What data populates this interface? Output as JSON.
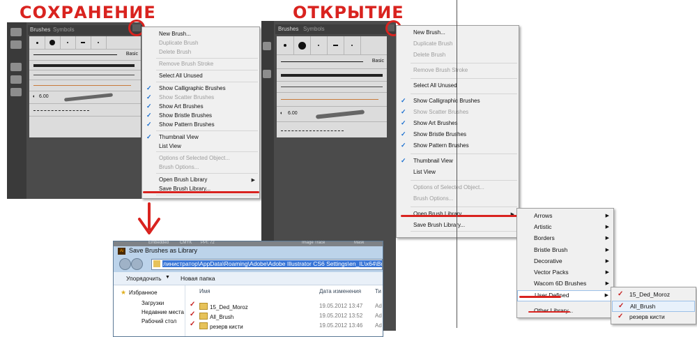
{
  "annotations": {
    "save_title": "СОХРАНЕНИЕ",
    "open_title": "ОТКРЫТИЕ"
  },
  "panel": {
    "tab_brushes": "Brushes",
    "tab_symbols": "Symbols",
    "basic_label": "Basic",
    "size_label": "6.00"
  },
  "left_menu": {
    "items": [
      {
        "label": "New Brush...",
        "enabled": true
      },
      {
        "label": "Duplicate Brush",
        "enabled": false
      },
      {
        "label": "Delete Brush",
        "enabled": false
      },
      {
        "label": "Remove Brush Stroke",
        "enabled": false
      },
      {
        "label": "Select All Unused",
        "enabled": true
      },
      {
        "label": "Show Calligraphic Brushes",
        "enabled": true,
        "checked": true
      },
      {
        "label": "Show Scatter Brushes",
        "enabled": false,
        "checked": true
      },
      {
        "label": "Show Art Brushes",
        "enabled": true,
        "checked": true
      },
      {
        "label": "Show Bristle Brushes",
        "enabled": true,
        "checked": true
      },
      {
        "label": "Show Pattern Brushes",
        "enabled": true,
        "checked": true
      },
      {
        "label": "Thumbnail View",
        "enabled": true,
        "checked": true
      },
      {
        "label": "List View",
        "enabled": true
      },
      {
        "label": "Options of Selected Object...",
        "enabled": false
      },
      {
        "label": "Brush Options...",
        "enabled": false
      },
      {
        "label": "Open Brush Library",
        "enabled": true,
        "submenu": true
      },
      {
        "label": "Save Brush Library...",
        "enabled": true
      }
    ]
  },
  "right_menu": {
    "items": [
      {
        "label": "New Brush...",
        "enabled": true
      },
      {
        "label": "Duplicate Brush",
        "enabled": false
      },
      {
        "label": "Delete Brush",
        "enabled": false
      },
      {
        "label": "Remove Brush Stroke",
        "enabled": false
      },
      {
        "label": "Select All Unused",
        "enabled": true
      },
      {
        "label": "Show Calligraphic Brushes",
        "enabled": true,
        "checked": true
      },
      {
        "label": "Show Scatter Brushes",
        "enabled": false,
        "checked": true
      },
      {
        "label": "Show Art Brushes",
        "enabled": true,
        "checked": true
      },
      {
        "label": "Show Bristle Brushes",
        "enabled": true,
        "checked": true
      },
      {
        "label": "Show Pattern Brushes",
        "enabled": true,
        "checked": true
      },
      {
        "label": "Thumbnail View",
        "enabled": true,
        "checked": true
      },
      {
        "label": "List View",
        "enabled": true
      },
      {
        "label": "Options of Selected Object...",
        "enabled": false
      },
      {
        "label": "Brush Options...",
        "enabled": false
      },
      {
        "label": "Open Brush Library",
        "enabled": true,
        "submenu": true
      },
      {
        "label": "Save Brush Library...",
        "enabled": true
      }
    ]
  },
  "library_submenu": [
    "Arrows",
    "Artistic",
    "Borders",
    "Bristle Brush",
    "Decorative",
    "Vector Packs",
    "Wacom 6D Brushes",
    "User Defined",
    "Other Library..."
  ],
  "user_defined_submenu": [
    "15_Ded_Moroz",
    "All_Brush",
    "резерв кисти"
  ],
  "dialog": {
    "title": "Save Brushes as Library",
    "path": "линистратор\\AppData\\Roaming\\Adobe\\Adobe Illustrator CS6 Settings\\en_IL\\x64\\Brushes",
    "organize": "Упорядочить",
    "new_folder": "Новая папка",
    "nav": [
      "Избранное",
      "Загрузки",
      "Недавние места",
      "Рабочий стол"
    ],
    "col_name": "Имя",
    "col_date": "Дата изменения",
    "col_type": "Ти",
    "files": [
      {
        "name": "15_Ded_Moroz",
        "date": "19.05.2012 13:47",
        "type": "Ad"
      },
      {
        "name": "All_Brush",
        "date": "19.05.2012 13:52",
        "type": "Ad"
      },
      {
        "name": "резерв кисти",
        "date": "19.05.2012 13:46",
        "type": "Ad"
      }
    ],
    "bg_tab_1": "Embedded",
    "bg_tab_2": "CMYK",
    "bg_tab_3": "PPI: 72",
    "bg_tab_4": "Image Trace",
    "bg_tab_5": "Mask"
  },
  "colors": {
    "annotation_red": "#d9231f",
    "panel_dark": "#4b4b4b",
    "menu_bg": "#f0f0f0",
    "check_blue": "#1a6fd0"
  }
}
